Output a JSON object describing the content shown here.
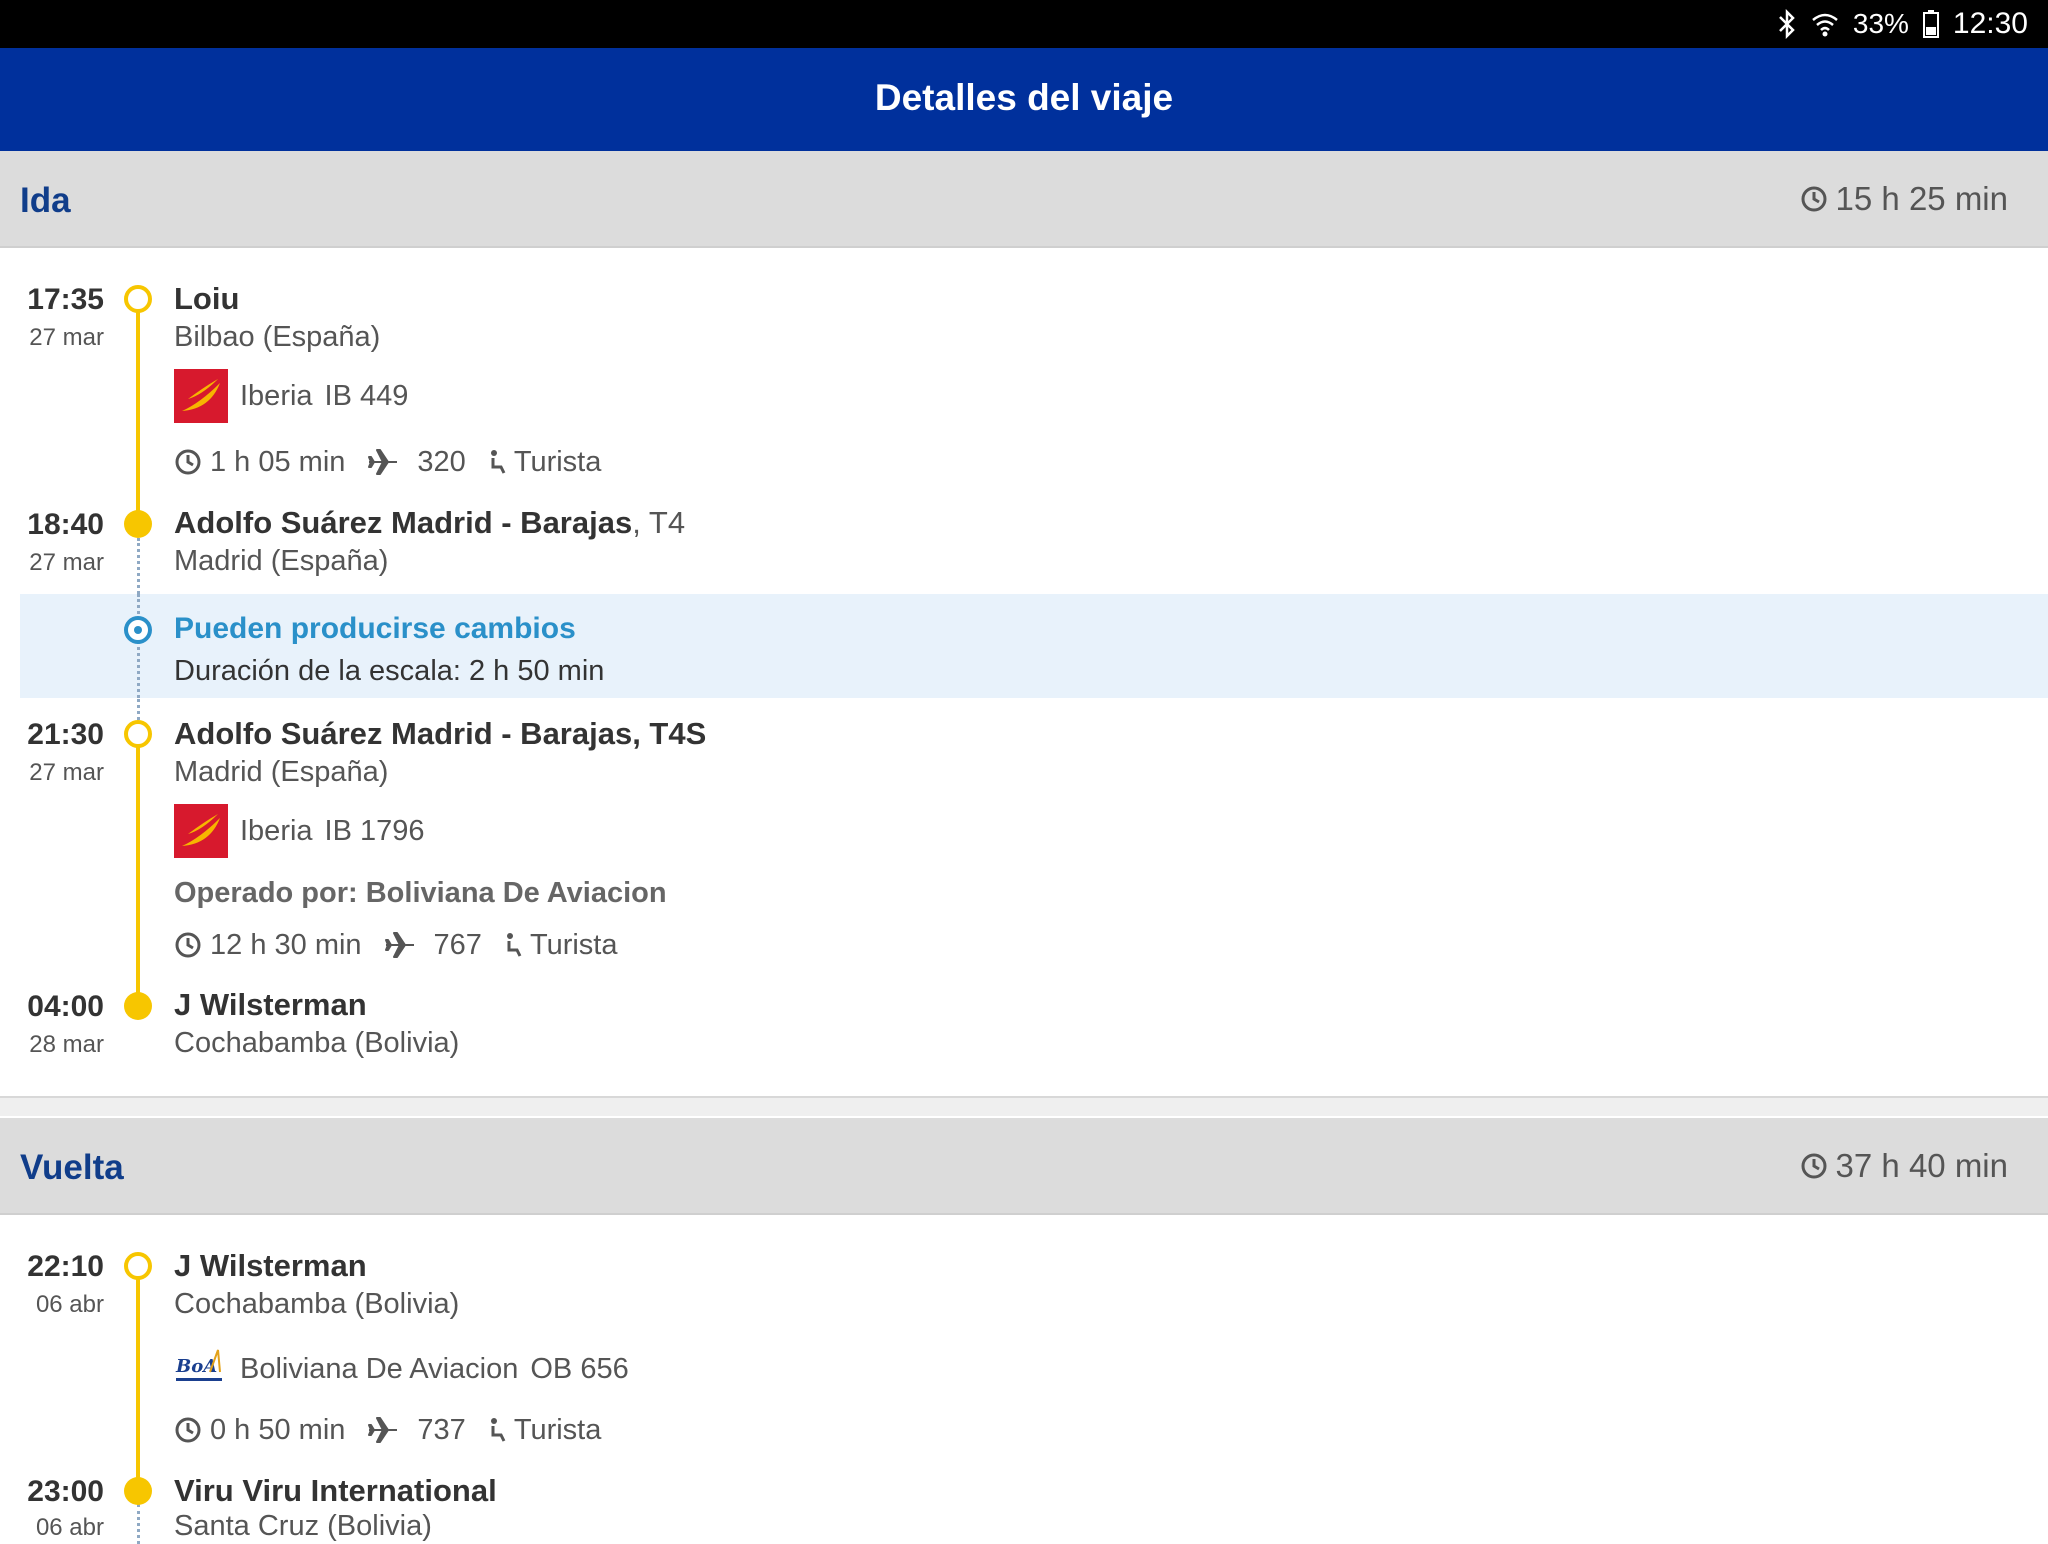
{
  "status_bar": {
    "battery": "33%",
    "time": "12:30"
  },
  "app_bar": {
    "title": "Detalles del viaje"
  },
  "outbound": {
    "title": "Ida",
    "total_duration": "15 h 25 min",
    "legs": [
      {
        "dep_time": "17:35",
        "dep_date": "27 mar",
        "dep_airport": "Loiu",
        "dep_city": "Bilbao (España)",
        "airline": "Iberia",
        "flight": "IB 449",
        "airline_logo": "iberia-logo",
        "duration": "1 h 05 min",
        "aircraft": "320",
        "cabin": "Turista",
        "arr_time": "18:40",
        "arr_date": "27 mar",
        "arr_airport": "Adolfo Suárez Madrid - Barajas",
        "arr_terminal": ", T4",
        "arr_city": "Madrid (España)"
      },
      {
        "dep_time": "21:30",
        "dep_date": "27 mar",
        "dep_airport": "Adolfo Suárez Madrid - Barajas, T4S",
        "dep_city": "Madrid (España)",
        "airline": "Iberia",
        "flight": "IB 1796",
        "airline_logo": "iberia-logo",
        "operated_by": "Operado por: Boliviana De Aviacion",
        "duration": "12 h 30 min",
        "aircraft": "767",
        "cabin": "Turista",
        "arr_time": "04:00",
        "arr_date": "28 mar",
        "arr_airport": "J Wilsterman",
        "arr_city": "Cochabamba (Bolivia)"
      }
    ],
    "layover": {
      "title": "Pueden producirse cambios",
      "text": "Duración de la escala: 2 h 50 min"
    }
  },
  "return": {
    "title": "Vuelta",
    "total_duration": "37 h 40 min",
    "legs": [
      {
        "dep_time": "22:10",
        "dep_date": "06 abr",
        "dep_airport": "J Wilsterman",
        "dep_city": "Cochabamba (Bolivia)",
        "airline": "Boliviana De Aviacion",
        "flight": "OB 656",
        "airline_logo": "boa-logo",
        "duration": "0 h 50 min",
        "aircraft": "737",
        "cabin": "Turista",
        "arr_time": "23:00",
        "arr_date": "06 abr",
        "arr_airport": "Viru Viru International",
        "arr_city": "Santa Cruz (Bolivia)"
      }
    ]
  },
  "colors": {
    "app_bar": "#00309c",
    "timeline": "#f7c600",
    "info": "#2a90c9",
    "section_header": "#dcdcdc"
  }
}
